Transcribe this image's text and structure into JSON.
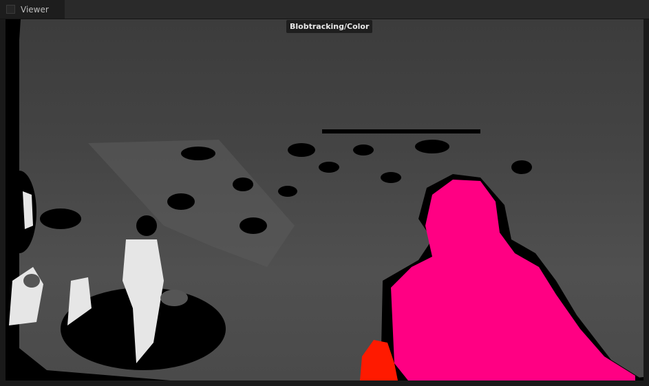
{
  "tab": {
    "label": "Viewer",
    "icon": "panel-icon"
  },
  "viewer": {
    "overlay_label": "Blobtracking/Color"
  },
  "colors": {
    "blob_primary": "#ff0083",
    "blob_secondary": "#ff1a00"
  }
}
